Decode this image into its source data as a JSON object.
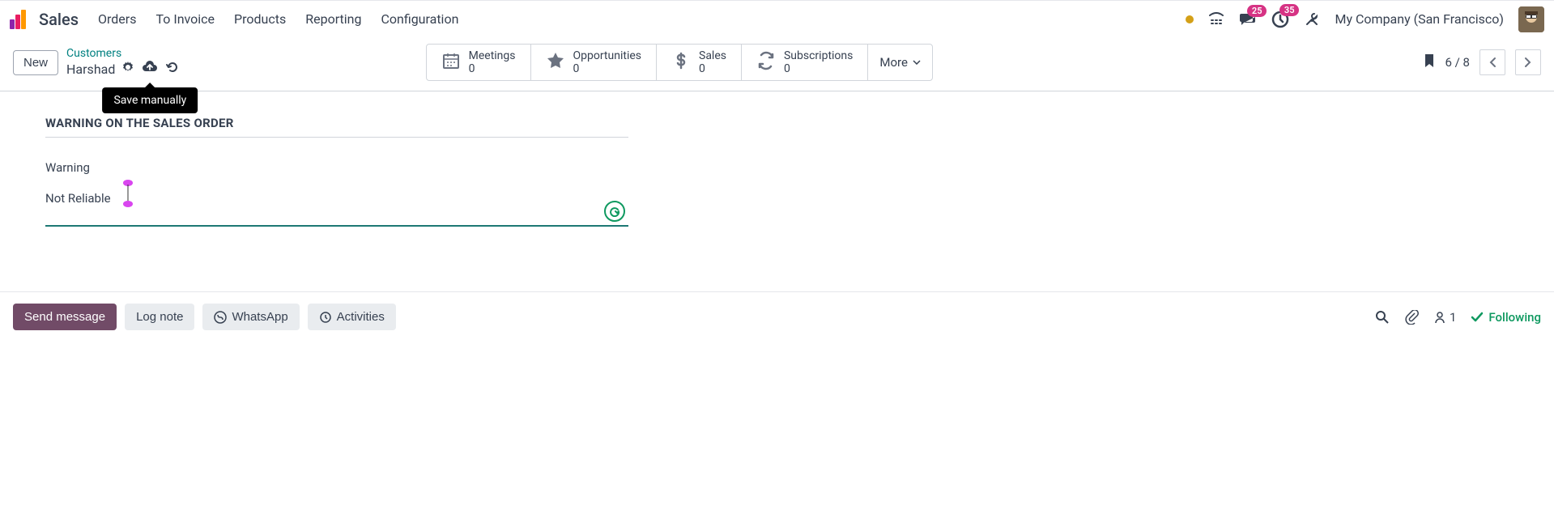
{
  "header": {
    "app_name": "Sales",
    "menu": [
      "Orders",
      "To Invoice",
      "Products",
      "Reporting",
      "Configuration"
    ],
    "company": "My Company (San Francisco)",
    "messages_badge": "25",
    "activities_badge": "35"
  },
  "breadcrumb": {
    "parent": "Customers",
    "current": "Harshad",
    "new_label": "New",
    "save_tooltip": "Save manually"
  },
  "stats": {
    "meetings": {
      "label": "Meetings",
      "value": "0"
    },
    "opportunities": {
      "label": "Opportunities",
      "value": "0"
    },
    "sales": {
      "label": "Sales",
      "value": "0"
    },
    "subscriptions": {
      "label": "Subscriptions",
      "value": "0"
    },
    "more_label": "More"
  },
  "pager": {
    "current": "6",
    "total": "8",
    "text": "6 / 8"
  },
  "form": {
    "section_title": "WARNING ON THE SALES ORDER",
    "field_label": "Warning",
    "field_value": "Not Reliable"
  },
  "chatter": {
    "send_message": "Send message",
    "log_note": "Log note",
    "whatsapp": "WhatsApp",
    "activities": "Activities",
    "follower_count": "1",
    "following": "Following"
  }
}
